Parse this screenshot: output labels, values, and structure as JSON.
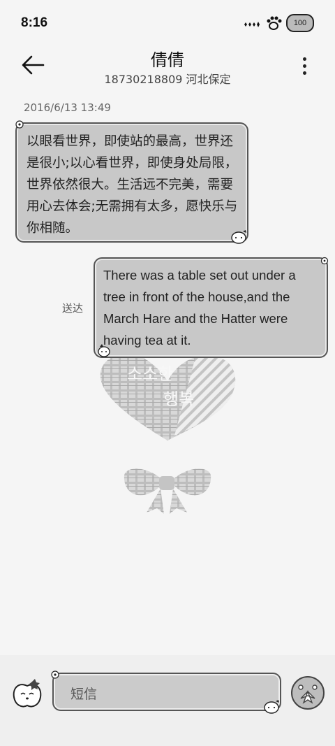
{
  "status_bar": {
    "time": "8:16",
    "battery": "100",
    "icons": [
      "signal-icon",
      "paw-icon",
      "battery-icon"
    ]
  },
  "header": {
    "contact_name": "倩倩",
    "subtitle": "18730218809 河北保定",
    "back_icon": "back-arrow-icon",
    "more_icon": "more-vertical-icon"
  },
  "conversation": {
    "timestamp": "2016/6/13 13:49",
    "messages": [
      {
        "direction": "incoming",
        "text": "以眼看世界，即使站的最高，世界还是很小;以心看世界，即使身处局限，世界依然很大。生活远不完美，需要用心去体会;无需拥有太多，愿快乐与你相随。"
      },
      {
        "direction": "outgoing",
        "text": "There was a table set out under a tree in front of the house,and the March Hare and the Hatter were having tea at it.",
        "status": "送达"
      }
    ]
  },
  "background_art": {
    "text_line_1": "소소한",
    "text_line_2": "행복"
  },
  "composer": {
    "placeholder": "短信",
    "emoji_icon": "apple-face-icon",
    "send_icon": "send-icon"
  },
  "colors": {
    "bubble_fill": "#c8c8c8",
    "bubble_border": "#555555",
    "background": "#f5f5f5"
  }
}
